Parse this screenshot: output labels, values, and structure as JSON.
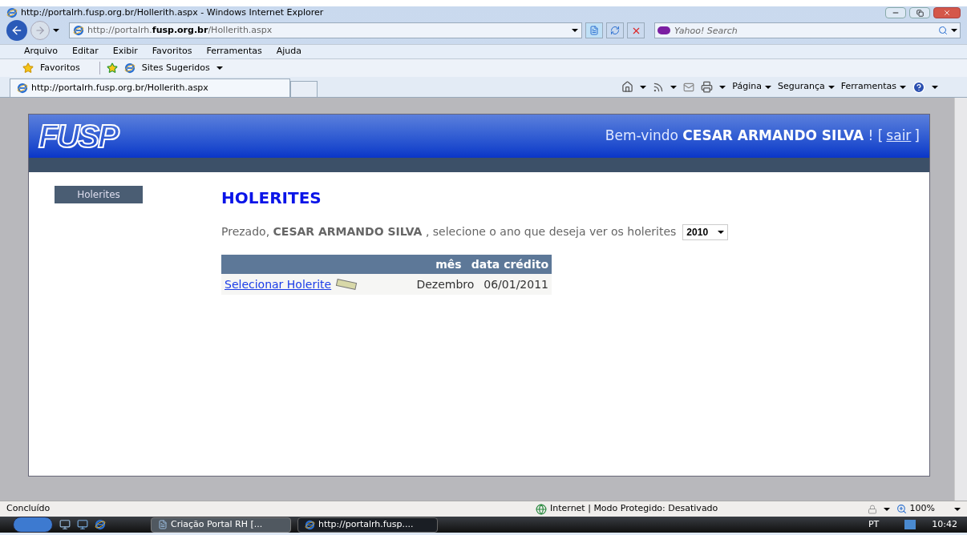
{
  "window": {
    "title": "http://portalrh.fusp.org.br/Hollerith.aspx - Windows Internet Explorer"
  },
  "address_bar": {
    "url": "http://portalrh.**fusp.org.br**/Hollerith.aspx"
  },
  "search": {
    "placeholder": "Yahoo! Search"
  },
  "menu": [
    "Arquivo",
    "Editar",
    "Exibir",
    "Favoritos",
    "Ferramentas",
    "Ajuda"
  ],
  "favorites_bar": {
    "favorites": "Favoritos",
    "suggested": "Sites Sugeridos"
  },
  "tab": {
    "title": "http://portalrh.fusp.org.br/Hollerith.aspx"
  },
  "command_bar": [
    "Página",
    "Segurança",
    "Ferramentas"
  ],
  "page": {
    "logo": "FUSP",
    "welcome": "Bem-vindo **CESAR ARMANDO SILVA** ! [",
    "logout_link": "sair",
    "welcome_end": "]",
    "sidebar": [
      {
        "label": "Holerites",
        "selected": true
      }
    ],
    "heading": "HOLERITES",
    "intro": "Prezado, **CESAR ARMANDO SILVA** , selecione o ano que deseja ver os holerites",
    "year": "2010",
    "table": {
      "columns": [
        "mês",
        "data crédito"
      ],
      "rows": [
        {
          "link": "Selecionar Holerite",
          "month": "Dezembro",
          "date": "06/01/2011"
        }
      ]
    }
  },
  "status_bar": {
    "text": "Concluído",
    "zone": "Internet | Modo Protegido: Desativado",
    "zoom": "100%"
  },
  "taskbar": {
    "items": [
      {
        "label": "Criação Portal RH [...",
        "selected": false
      },
      {
        "label": "http://portalrh.fusp....",
        "selected": true
      }
    ],
    "language": "PT",
    "time": "10:42"
  }
}
